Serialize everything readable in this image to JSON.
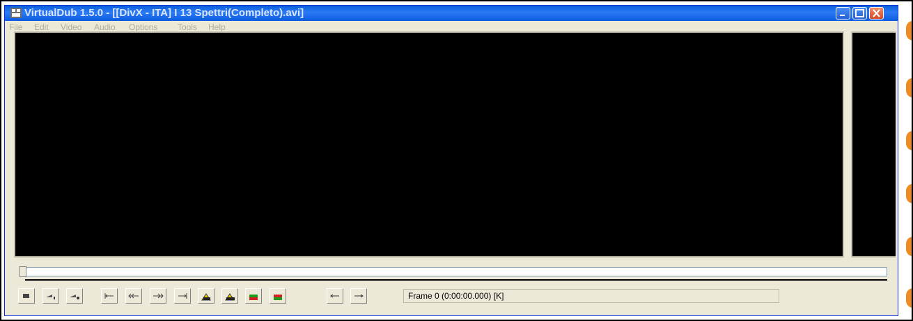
{
  "window": {
    "title": "VirtualDub 1.5.0 - [[DivX - ITA]  I 13 Spettri(Completo).avi]",
    "controls": {
      "minimize": "minimize",
      "maximize": "maximize",
      "close": "close"
    }
  },
  "menu": [
    "File",
    "Edit",
    "Video",
    "Audio",
    "Options",
    "Tools",
    "Help"
  ],
  "toolbar": {
    "buttons": [
      {
        "name": "stop-button",
        "icon": "stop-icon"
      },
      {
        "name": "play-input-button",
        "icon": "play-input-icon"
      },
      {
        "name": "play-output-button",
        "icon": "play-output-icon"
      },
      {
        "name": "go-start-button",
        "icon": "go-start-icon"
      },
      {
        "name": "back-button",
        "icon": "back-icon"
      },
      {
        "name": "forward-button",
        "icon": "forward-icon"
      },
      {
        "name": "go-end-button",
        "icon": "go-end-icon"
      },
      {
        "name": "prev-keyframe-button",
        "icon": "keyframe-prev-icon"
      },
      {
        "name": "next-keyframe-button",
        "icon": "keyframe-next-icon"
      },
      {
        "name": "scene-back-button",
        "icon": "scene-back-icon"
      },
      {
        "name": "scene-forward-button",
        "icon": "scene-forward-icon"
      },
      {
        "name": "mark-in-button",
        "icon": "mark-in-icon"
      },
      {
        "name": "mark-out-button",
        "icon": "mark-out-icon"
      }
    ]
  },
  "status": {
    "frame": "Frame 0 (0:00:00.000) [K]"
  },
  "colors": {
    "titlebar": "#0a5fdc",
    "close": "#d64a24",
    "accent_tab": "#f08a24"
  }
}
